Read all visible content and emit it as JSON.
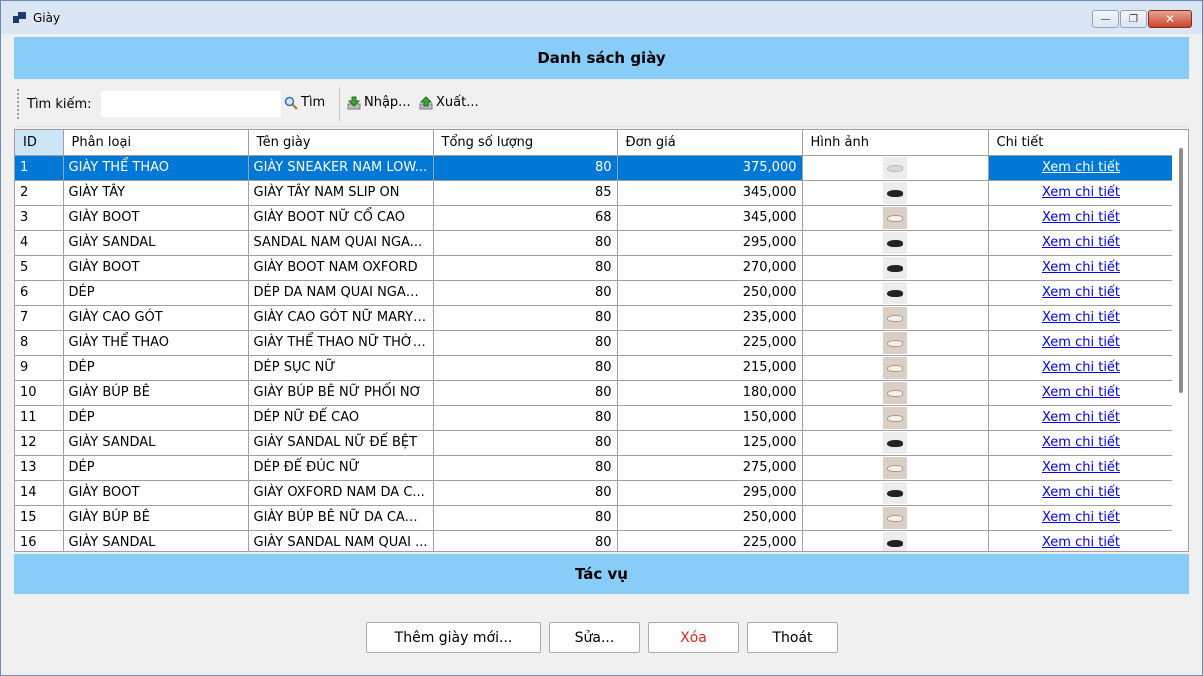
{
  "window": {
    "title": "Giày",
    "minimize_label": "—",
    "restore_label": "❐",
    "close_label": "✕"
  },
  "header": {
    "title": "Danh sách giày"
  },
  "toolbar": {
    "search_label": "Tìm kiếm:",
    "search_value": "",
    "find_label": "Tìm",
    "import_label": "Nhập...",
    "export_label": "Xuất..."
  },
  "table": {
    "columns": [
      "ID",
      "Phân loại",
      "Tên giày",
      "Tổng số lượng",
      "Đơn giá",
      "Hình ảnh",
      "Chi tiết"
    ],
    "selected_row": 0,
    "rows": [
      {
        "id": "1",
        "category": "GIÀY THỂ THAO",
        "name": "GIÀY SNEAKER NAM LOW...",
        "qty": "80",
        "price": "375,000",
        "link": "Xem chi tiết",
        "img": "light"
      },
      {
        "id": "2",
        "category": "GIÀY TÂY",
        "name": "GIÀY TÂY NAM SLIP ON",
        "qty": "85",
        "price": "345,000",
        "link": "Xem chi tiết",
        "img": "dark"
      },
      {
        "id": "3",
        "category": "GIÀY BOOT",
        "name": "GIÀY BOOT NỮ CỔ CAO",
        "qty": "68",
        "price": "345,000",
        "link": "Xem chi tiết",
        "img": "tan"
      },
      {
        "id": "4",
        "category": "GIÀY SANDAL",
        "name": "SANDAL NAM QUAI NGA...",
        "qty": "80",
        "price": "295,000",
        "link": "Xem chi tiết",
        "img": "dark"
      },
      {
        "id": "5",
        "category": "GIÀY BOOT",
        "name": "GIÀY BOOT NAM OXFORD",
        "qty": "80",
        "price": "270,000",
        "link": "Xem chi tiết",
        "img": "dark"
      },
      {
        "id": "6",
        "category": "DÉP",
        "name": "DÉP DA NAM QUAI NGAN...",
        "qty": "80",
        "price": "250,000",
        "link": "Xem chi tiết",
        "img": "dark"
      },
      {
        "id": "7",
        "category": "GIÀY CAO GÓT",
        "name": "GIÀY CAO GÓT NỮ MARY ...",
        "qty": "80",
        "price": "235,000",
        "link": "Xem chi tiết",
        "img": "tan"
      },
      {
        "id": "8",
        "category": "GIÀY THỂ THAO",
        "name": "GIÀY THỂ THAO NỮ THỜI ...",
        "qty": "80",
        "price": "225,000",
        "link": "Xem chi tiết",
        "img": "tan"
      },
      {
        "id": "9",
        "category": "DÉP",
        "name": "DÉP SỤC NỮ",
        "qty": "80",
        "price": "215,000",
        "link": "Xem chi tiết",
        "img": "tan"
      },
      {
        "id": "10",
        "category": "GIÀY BÚP BÊ",
        "name": "GIÀY BÚP BÊ NỮ PHỐI NƠ",
        "qty": "80",
        "price": "180,000",
        "link": "Xem chi tiết",
        "img": "tan"
      },
      {
        "id": "11",
        "category": "DÉP",
        "name": "DÉP NỮ ĐẾ CAO",
        "qty": "80",
        "price": "150,000",
        "link": "Xem chi tiết",
        "img": "tan"
      },
      {
        "id": "12",
        "category": "GIÀY SANDAL",
        "name": "GIÀY SANDAL NỮ ĐẾ BỆT",
        "qty": "80",
        "price": "125,000",
        "link": "Xem chi tiết",
        "img": "dark"
      },
      {
        "id": "13",
        "category": "DÉP",
        "name": "DÉP ĐẾ ĐÚC NỮ",
        "qty": "80",
        "price": "275,000",
        "link": "Xem chi tiết",
        "img": "tan"
      },
      {
        "id": "14",
        "category": "GIÀY BOOT",
        "name": "GIÀY OXFORD NAM DA C...",
        "qty": "80",
        "price": "295,000",
        "link": "Xem chi tiết",
        "img": "dark"
      },
      {
        "id": "15",
        "category": "GIÀY BÚP BÊ",
        "name": "GIÀY BÚP BÊ NỮ DA CAO ...",
        "qty": "80",
        "price": "250,000",
        "link": "Xem chi tiết",
        "img": "tan"
      },
      {
        "id": "16",
        "category": "GIÀY SANDAL",
        "name": "GIÀY SANDAL NAM QUAI ...",
        "qty": "80",
        "price": "225,000",
        "link": "Xem chi tiết",
        "img": "dark"
      }
    ]
  },
  "actions": {
    "title": "Tác vụ",
    "add_label": "Thêm giày mới...",
    "edit_label": "Sửa...",
    "delete_label": "Xóa",
    "exit_label": "Thoát"
  },
  "colors": {
    "band": "#87cdf8",
    "selection": "#0078d7",
    "delete_text": "#e0281e"
  }
}
